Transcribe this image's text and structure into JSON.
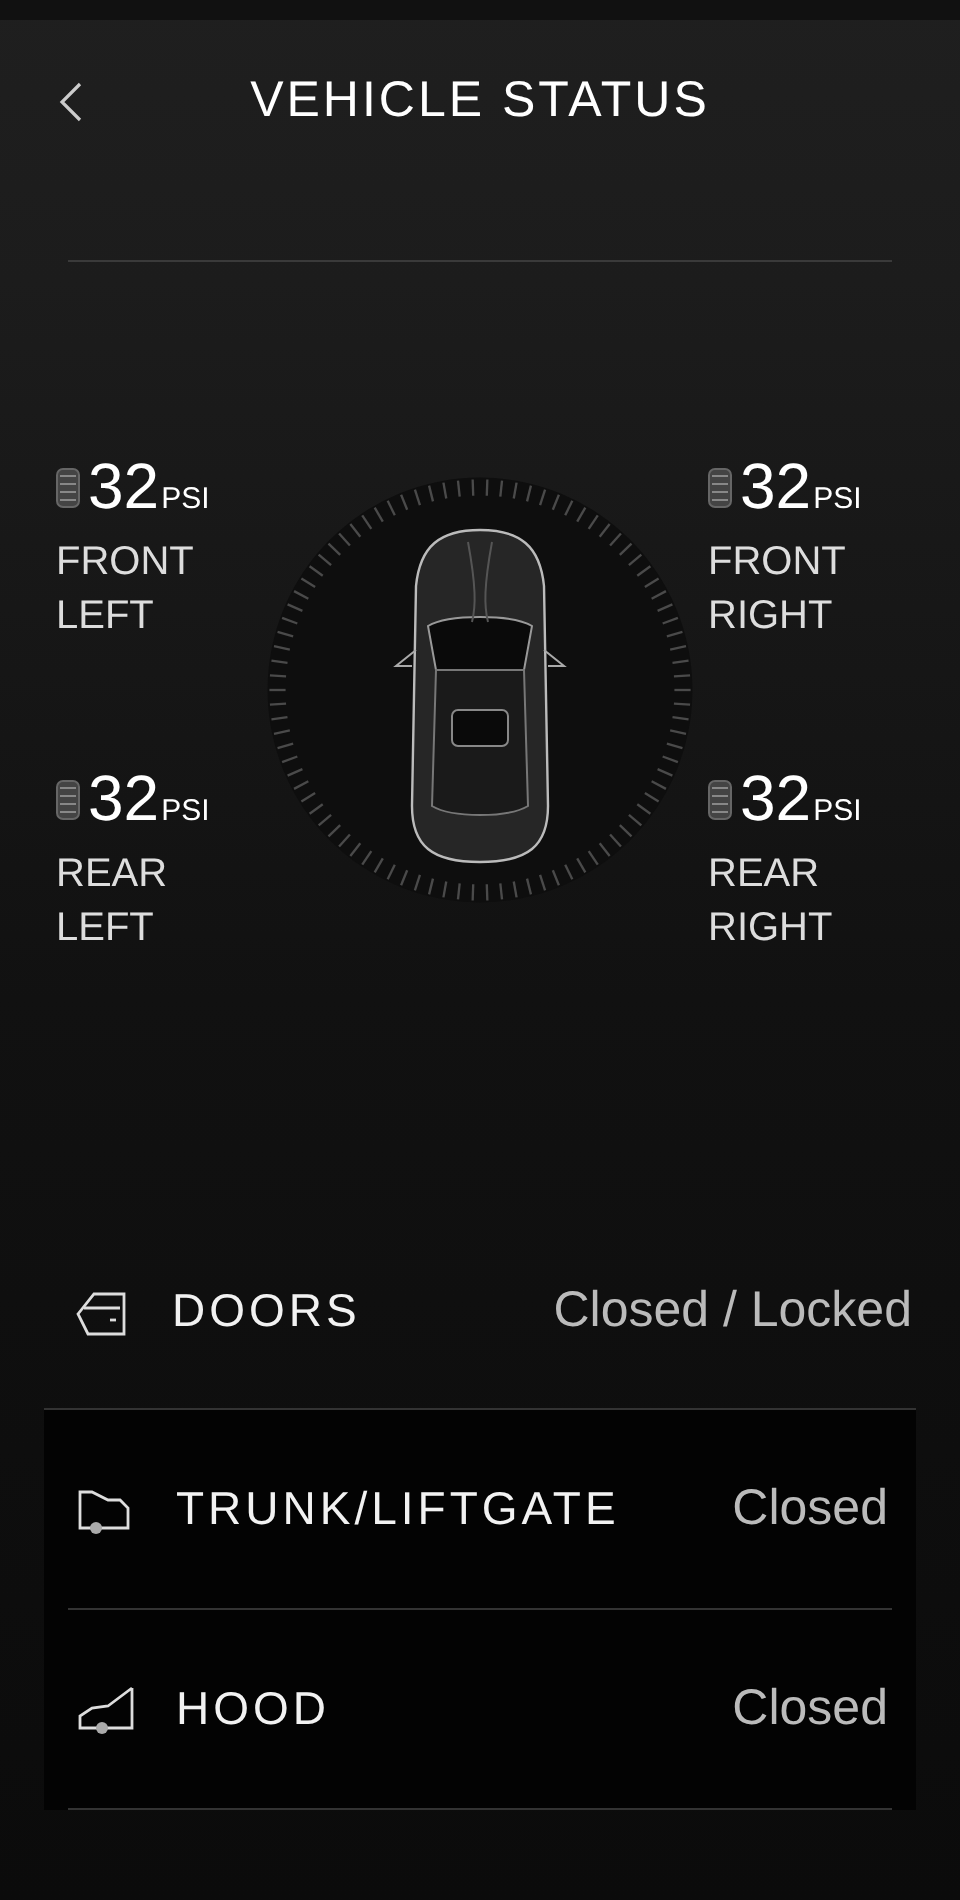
{
  "header": {
    "title": "VEHICLE STATUS"
  },
  "tires": [
    {
      "value": "32",
      "unit": "PSI",
      "label": "FRONT LEFT"
    },
    {
      "value": "32",
      "unit": "PSI",
      "label": "FRONT RIGHT"
    },
    {
      "value": "32",
      "unit": "PSI",
      "label": "REAR LEFT"
    },
    {
      "value": "32",
      "unit": "PSI",
      "label": "REAR RIGHT"
    }
  ],
  "statuses": [
    {
      "kind": "door",
      "label": "DOORS",
      "value": "Closed / Locked"
    },
    {
      "kind": "trunk",
      "label": "TRUNK/LIFTGATE",
      "value": "Closed"
    },
    {
      "kind": "hood",
      "label": "HOOD",
      "value": "Closed"
    }
  ]
}
